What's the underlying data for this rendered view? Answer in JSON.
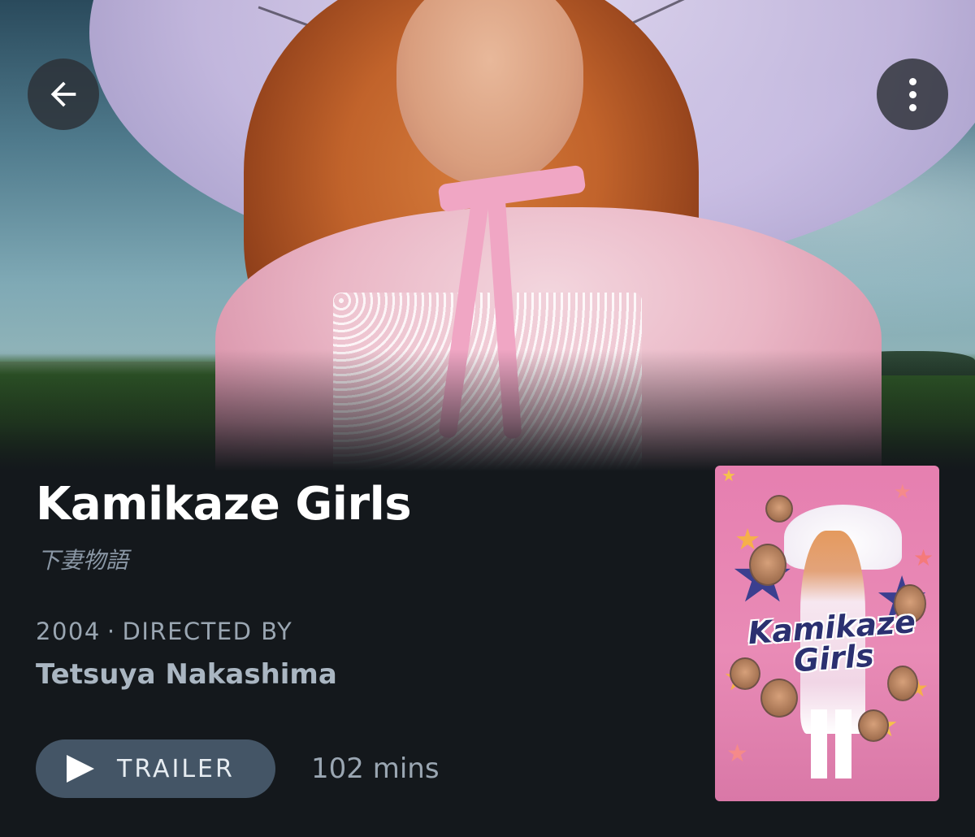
{
  "film": {
    "title": "Kamikaze Girls",
    "original_title": "下妻物語",
    "year": "2004",
    "separator": "·",
    "directed_by_label": "DIRECTED BY",
    "director": "Tetsuya Nakashima",
    "runtime": "102 mins"
  },
  "actions": {
    "trailer_label": "TRAILER"
  },
  "poster": {
    "title_line1": "Kamikaze",
    "title_line2": "Girls"
  },
  "icons": {
    "back": "arrow-left-icon",
    "more": "more-vertical-icon",
    "play": "play-icon"
  },
  "colors": {
    "background": "#14181c",
    "button": "#445566",
    "muted_text": "#9aa6b2",
    "poster_pink": "#e67fb0"
  }
}
